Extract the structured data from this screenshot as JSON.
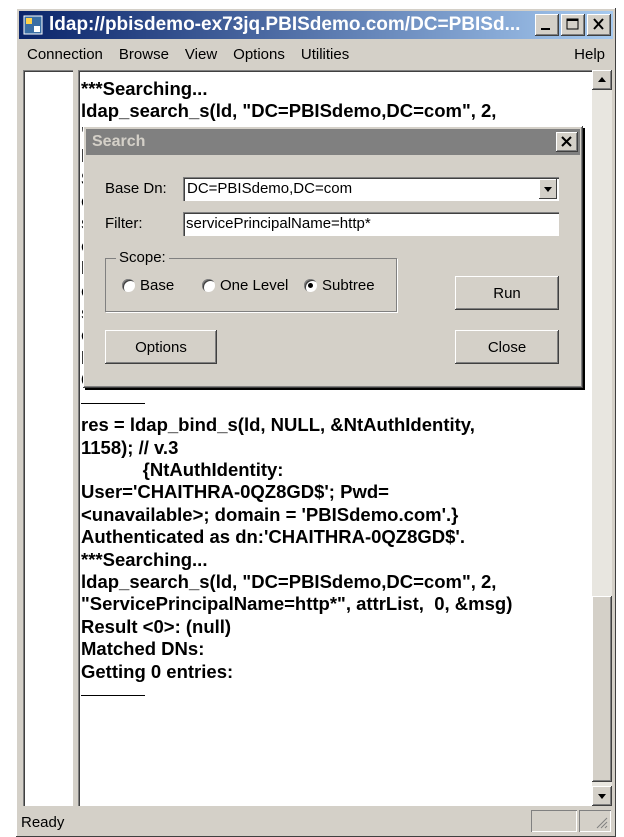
{
  "window": {
    "title": "ldap://pbisdemo-ex73jq.PBISdemo.com/DC=PBISd...",
    "icon_name": "ldap-app-icon"
  },
  "menu": {
    "items": [
      "Connection",
      "Browse",
      "View",
      "Options",
      "Utilities"
    ],
    "help": "Help"
  },
  "output": {
    "lines": [
      "***Searching...",
      "ldap_search_s(ld, \"DC=PBISdemo,DC=com\", 2,",
      "\"",
      "E",
      "S",
      "c",
      "s",
      "c",
      "F",
      "c",
      "s",
      "c",
      "Matched DNs:",
      "Getting 0 entries:",
      "---",
      "res = ldap_bind_s(ld, NULL, &NtAuthIdentity,",
      "1158); // v.3",
      "            {NtAuthIdentity:",
      "User='CHAITHRA-0QZ8GD$'; Pwd=",
      "<unavailable>; domain = 'PBISdemo.com'.}",
      "Authenticated as dn:'CHAITHRA-0QZ8GD$'.",
      "***Searching...",
      "ldap_search_s(ld, \"DC=PBISdemo,DC=com\", 2,",
      "\"ServicePrincipalName=http*\", attrList,  0, &msg)",
      "Result <0>: (null)",
      "Matched DNs:",
      "Getting 0 entries:",
      "---"
    ]
  },
  "status": {
    "text": "Ready"
  },
  "dialog": {
    "title": "Search",
    "base_dn_label": "Base Dn:",
    "base_dn_value": "DC=PBISdemo,DC=com",
    "filter_label": "Filter:",
    "filter_value": "servicePrincipalName=http*",
    "scope_label": "Scope:",
    "scope_options": [
      "Base",
      "One Level",
      "Subtree"
    ],
    "scope_selected": "Subtree",
    "run_label": "Run",
    "options_label": "Options",
    "close_label": "Close"
  }
}
